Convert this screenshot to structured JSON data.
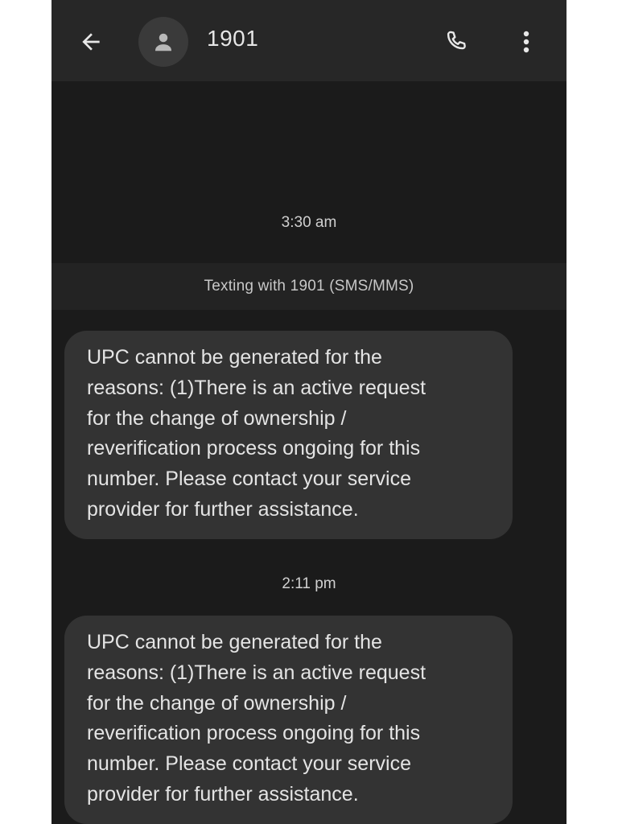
{
  "app_bar": {
    "back_icon": "arrow-left-icon",
    "avatar_icon": "person-icon",
    "contact_name": "1901",
    "call_icon": "phone-icon",
    "menu_icon": "more-vertical-icon"
  },
  "conversation": {
    "texting_with": "Texting with 1901 (SMS/MMS)",
    "items": [
      {
        "timestamp": "3:30 am",
        "message": "UPC cannot be generated for the\nreasons:  (1)There is an active request\nfor the change of ownership /\nreverification process ongoing for this\nnumber. Please contact your service\nprovider for further assistance."
      },
      {
        "timestamp": "2:11 pm",
        "message": "UPC cannot be generated for the\nreasons:  (1)There is an active request\nfor the change of ownership /\nreverification process ongoing for this\nnumber. Please contact your service\nprovider for further assistance."
      }
    ]
  },
  "colors": {
    "background": "#1b1b1b",
    "app_bar": "#272727",
    "bubble": "#333333",
    "text": "#e4e4e4"
  }
}
